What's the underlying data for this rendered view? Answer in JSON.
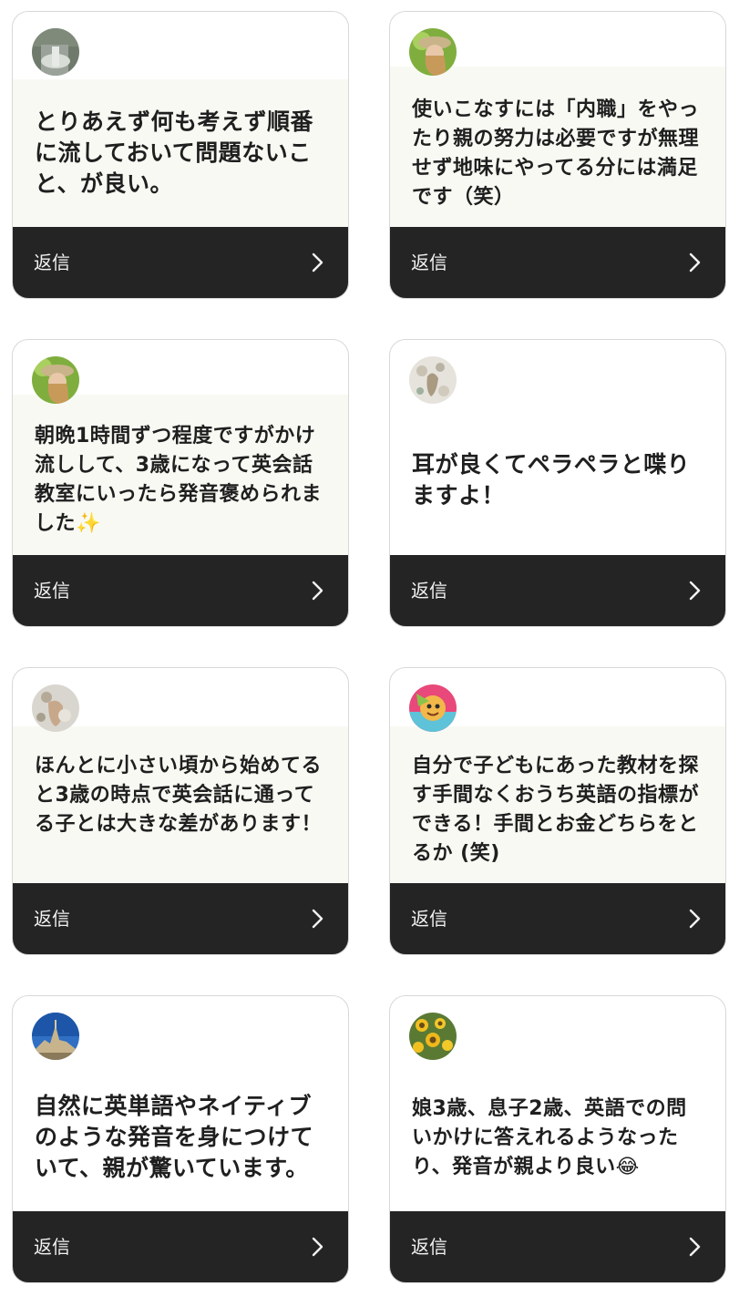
{
  "colors": {
    "footer": "#242424",
    "highlight": "#f9f9f4",
    "border": "#d8d8d8"
  },
  "cards": [
    {
      "avatar": "waterfall-photo-avatar",
      "message": "とりあえず何も考えず順番に流しておいて問題ないこと、が良い。",
      "reply_label": "返信"
    },
    {
      "avatar": "woman-hat-photo-avatar",
      "message": "使いこなすには「内職」をやったり親の努力は必要ですが無理せず地味にやってる分には満足です（笑）",
      "reply_label": "返信"
    },
    {
      "avatar": "woman-hat-photo-avatar",
      "message": "朝晩1時間ずつ程度ですがかけ流しして、3歳になって英会話教室にいったら発音褒められました✨",
      "reply_label": "返信"
    },
    {
      "avatar": "floral-illustration-avatar",
      "message": "耳が良くてペラペラと喋りますよ！",
      "reply_label": "返信"
    },
    {
      "avatar": "child-photo-avatar",
      "message": "ほんとに小さい頃から始めてると3歳の時点で英会話に通ってる子とは大きな差があります！",
      "reply_label": "返信"
    },
    {
      "avatar": "cartoon-character-avatar",
      "message": "自分で子どもにあった教材を探す手間なくおうち英語の指標ができる！手間とお金どちらをとるか (笑)",
      "reply_label": "返信"
    },
    {
      "avatar": "mont-saint-michel-photo-avatar",
      "message": "自然に英単語やネイティブのような発音を身につけていて、親が驚いています。",
      "reply_label": "返信"
    },
    {
      "avatar": "sunflower-photo-avatar",
      "message": "娘3歳、息子2歳、英語での問いかけに答えれるようなったり、発音が親より良い😂",
      "reply_label": "返信"
    }
  ]
}
